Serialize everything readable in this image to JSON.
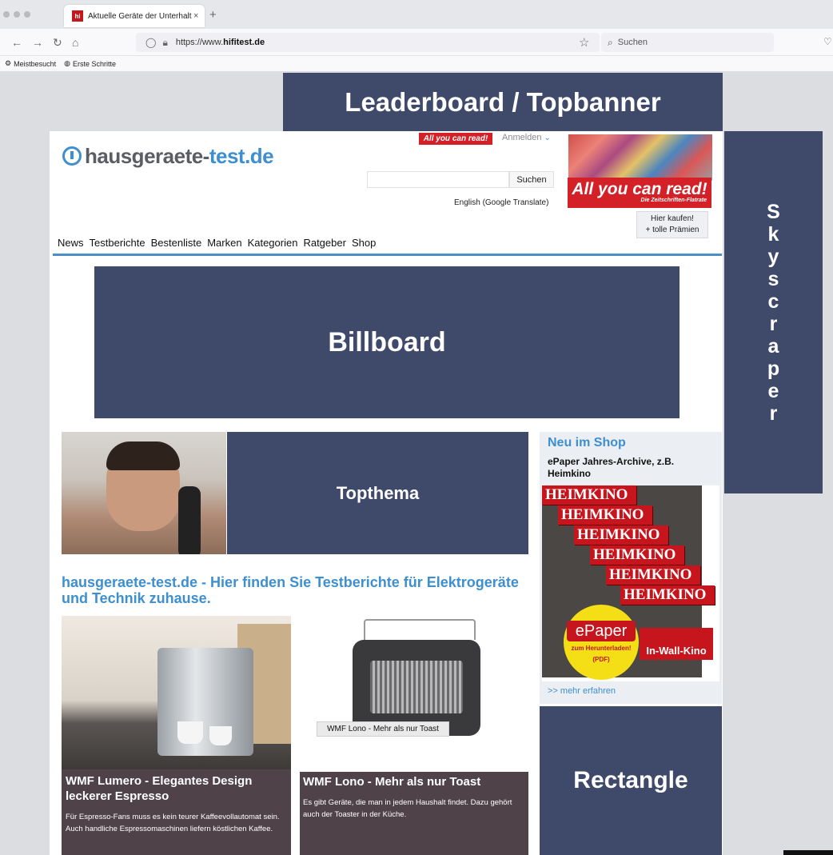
{
  "browser": {
    "tab_title": "Aktuelle Geräte der Unterhaltun",
    "tab_close": "×",
    "tab_favicon": "hi",
    "new_tab": "+",
    "url_prefix": "https://www.",
    "url_domain": "hifitest.de",
    "search_placeholder": "Suchen",
    "bookmarks": [
      "Meistbesucht",
      "Erste Schritte"
    ]
  },
  "ads": {
    "leaderboard": "Leaderboard / Topbanner",
    "skyscraper_letters": [
      "S",
      "k",
      "y",
      "s",
      "c",
      "r",
      "a",
      "p",
      "e",
      "r"
    ],
    "billboard": "Billboard",
    "topthema": "Topthema",
    "rectangle": "Rectangle"
  },
  "site": {
    "logo_gray": "hausgeraete-",
    "logo_blue": "test.de",
    "ayc_small": "All you can read!",
    "login": "Anmelden",
    "search_button": "Suchen",
    "translate": "English (Google Translate)",
    "ayc_big": "All you can read!",
    "ayc_big_sub": "Die Zeitschriften-Flatrate",
    "buy_line1": "Hier kaufen!",
    "buy_line2": "+ tolle Prämien",
    "nav": [
      "News",
      "Testberichte",
      "Bestenliste",
      "Marken",
      "Kategorien",
      "Ratgeber",
      "Shop"
    ]
  },
  "headline": "hausgeraete-test.de - Hier finden Sie Testberichte für Elektrogeräte und Technik zuhause.",
  "shop": {
    "title": "Neu im Shop",
    "subtitle": "ePaper Jahres-Archive, z.B. Heimkino",
    "mag_title": "HEIMKINO",
    "epaper": "ePaper",
    "epaper_sub1": "zum Herunterladen!",
    "epaper_sub2": "(PDF)",
    "inwall": "In-Wall-Kino",
    "more": ">> mehr erfahren"
  },
  "articles": [
    {
      "title": "WMF Lumero - Elegantes Design leckerer Espresso",
      "text": "Für Espresso-Fans muss es kein teurer Kaffeevollautomat sein. Auch handliche Espressomaschinen liefern köstlichen Kaffee."
    },
    {
      "caption": "WMF Lono - Mehr als nur Toast",
      "title": "WMF Lono - Mehr als nur Toast",
      "text": "Es gibt Geräte, die man in jedem Haushalt findet. Dazu gehört auch der Toaster in der Küche."
    }
  ]
}
